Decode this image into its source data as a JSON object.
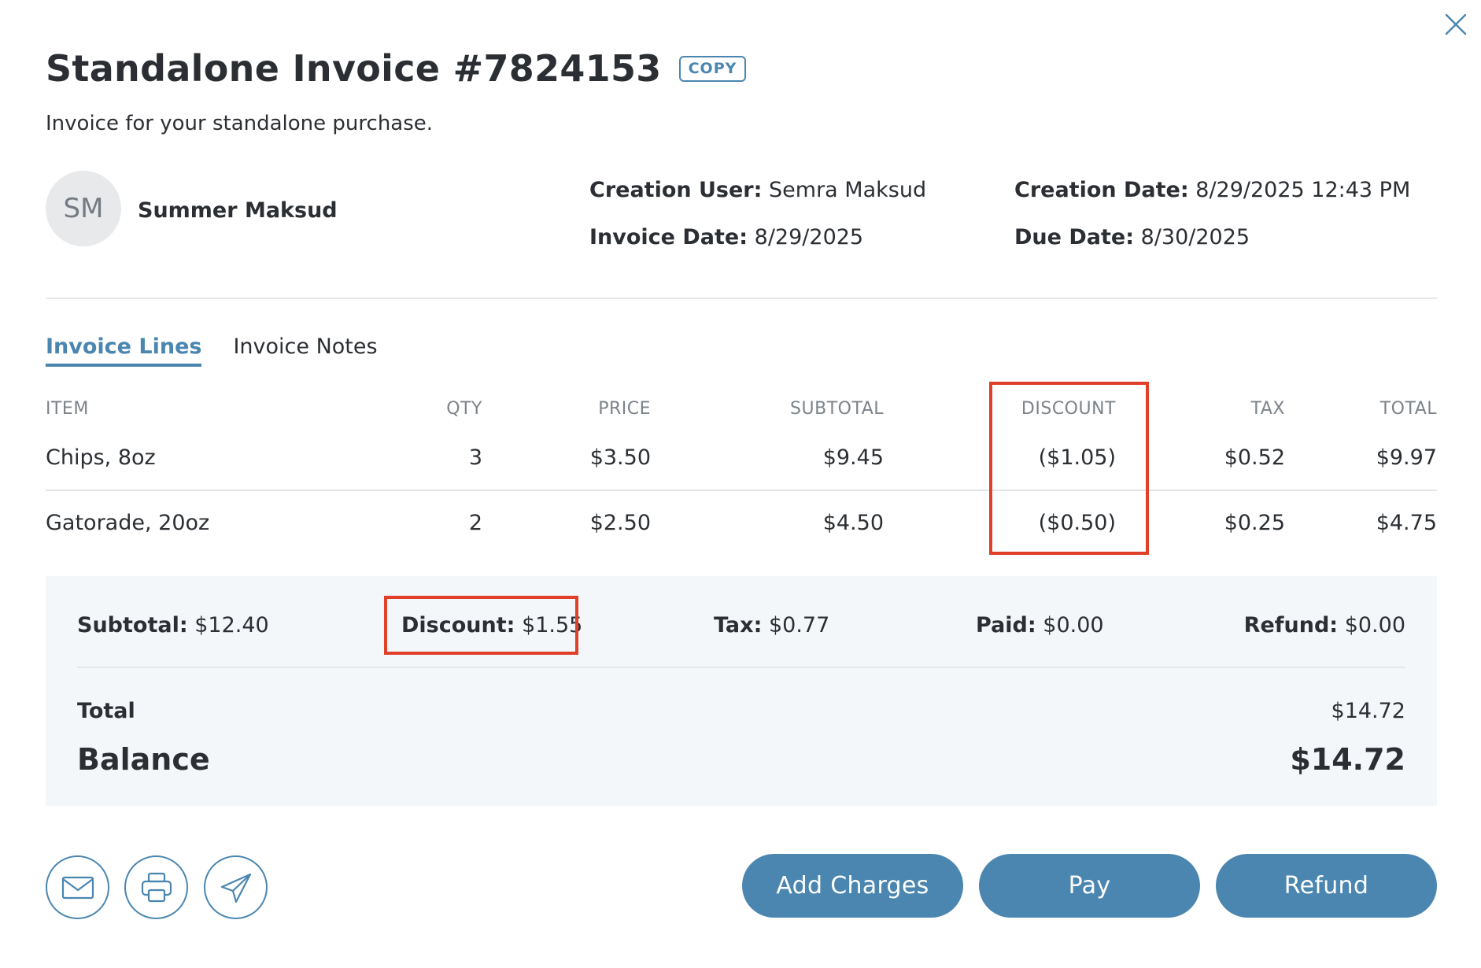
{
  "header": {
    "title": "Standalone Invoice #7824153",
    "copy_label": "COPY",
    "subtitle": "Invoice for your standalone purchase."
  },
  "customer": {
    "initials": "SM",
    "name": "Summer Maksud"
  },
  "meta": {
    "creation_user_label": "Creation User",
    "creation_user": "Semra Maksud",
    "invoice_date_label": "Invoice Date",
    "invoice_date": "8/29/2025",
    "creation_date_label": "Creation Date",
    "creation_date": "8/29/2025 12:43 PM",
    "due_date_label": "Due Date",
    "due_date": "8/30/2025"
  },
  "tabs": [
    {
      "label": "Invoice Lines",
      "active": true
    },
    {
      "label": "Invoice Notes",
      "active": false
    }
  ],
  "table": {
    "headers": [
      "ITEM",
      "QTY",
      "PRICE",
      "SUBTOTAL",
      "DISCOUNT",
      "TAX",
      "TOTAL"
    ],
    "rows": [
      {
        "item": "Chips, 8oz",
        "qty": "3",
        "price": "$3.50",
        "subtotal": "$9.45",
        "discount": "($1.05)",
        "tax": "$0.52",
        "total": "$9.97"
      },
      {
        "item": "Gatorade, 20oz",
        "qty": "2",
        "price": "$2.50",
        "subtotal": "$4.50",
        "discount": "($0.50)",
        "tax": "$0.25",
        "total": "$4.75"
      }
    ]
  },
  "summary": {
    "subtotal_label": "Subtotal",
    "subtotal": "$12.40",
    "discount_label": "Discount",
    "discount": "$1.55",
    "tax_label": "Tax",
    "tax": "$0.77",
    "paid_label": "Paid",
    "paid": "$0.00",
    "refund_label": "Refund",
    "refund": "$0.00",
    "total_label": "Total",
    "total": "$14.72",
    "balance_label": "Balance",
    "balance": "$14.72"
  },
  "actions": {
    "icons": [
      "envelope-icon",
      "printer-icon",
      "paper-plane-icon"
    ],
    "add_charges": "Add Charges",
    "pay": "Pay",
    "refund": "Refund"
  },
  "colors": {
    "accent": "#4a86b0",
    "highlight": "#e0402a",
    "summary_bg": "#f4f7f9",
    "text": "#2b2f33",
    "muted": "#7c838a"
  }
}
